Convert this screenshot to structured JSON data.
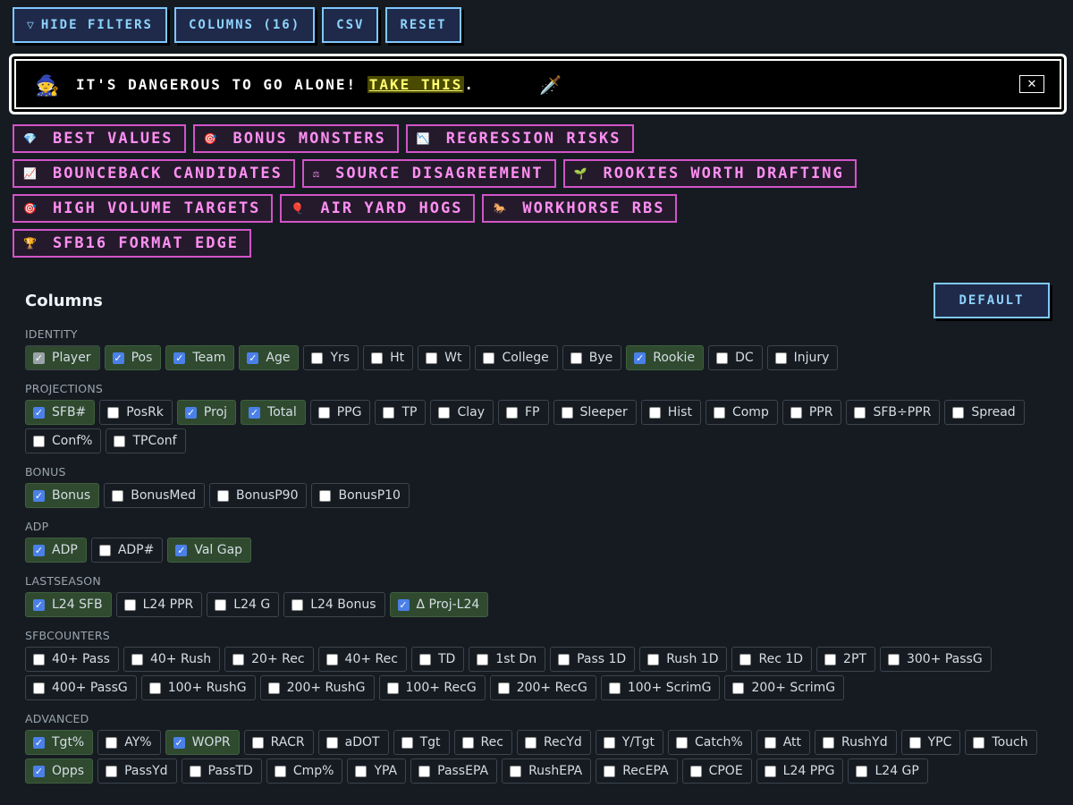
{
  "toolbar": {
    "hide_filters": "HIDE FILTERS",
    "filter_icon": "filter-icon",
    "columns": "COLUMNS (16)",
    "csv": "CSV",
    "reset": "RESET"
  },
  "banner": {
    "icon": "wizard-icon",
    "text_before": "IT'S DANGEROUS TO GO ALONE! ",
    "highlight": "TAKE THIS",
    "text_after": ".",
    "sword_icon": "sword-icon",
    "close": "✕"
  },
  "presets": [
    [
      {
        "label": "BEST VALUES",
        "icon": "💎"
      },
      {
        "label": "BONUS MONSTERS",
        "icon": "🎯"
      },
      {
        "label": "REGRESSION RISKS",
        "icon": "📉"
      }
    ],
    [
      {
        "label": "BOUNCEBACK CANDIDATES",
        "icon": "📈"
      },
      {
        "label": "SOURCE DISAGREEMENT",
        "icon": "⚖"
      },
      {
        "label": "ROOKIES WORTH DRAFTING",
        "icon": "🌱"
      }
    ],
    [
      {
        "label": "HIGH VOLUME TARGETS",
        "icon": "🎯"
      },
      {
        "label": "AIR YARD HOGS",
        "icon": "🎈"
      },
      {
        "label": "WORKHORSE RBS",
        "icon": "🐎"
      }
    ],
    [
      {
        "label": "SFB16 FORMAT EDGE",
        "icon": "🏆"
      }
    ]
  ],
  "columns_panel": {
    "title": "Columns",
    "default_button": "DEFAULT",
    "groups": [
      {
        "name": "IDENTITY",
        "items": [
          {
            "label": "Player",
            "checked": true,
            "locked": true
          },
          {
            "label": "Pos",
            "checked": true
          },
          {
            "label": "Team",
            "checked": true
          },
          {
            "label": "Age",
            "checked": true
          },
          {
            "label": "Yrs",
            "checked": false
          },
          {
            "label": "Ht",
            "checked": false
          },
          {
            "label": "Wt",
            "checked": false
          },
          {
            "label": "College",
            "checked": false
          },
          {
            "label": "Bye",
            "checked": false
          },
          {
            "label": "Rookie",
            "checked": true
          },
          {
            "label": "DC",
            "checked": false
          },
          {
            "label": "Injury",
            "checked": false
          }
        ]
      },
      {
        "name": "PROJECTIONS",
        "items": [
          {
            "label": "SFB#",
            "checked": true
          },
          {
            "label": "PosRk",
            "checked": false
          },
          {
            "label": "Proj",
            "checked": true
          },
          {
            "label": "Total",
            "checked": true
          },
          {
            "label": "PPG",
            "checked": false
          },
          {
            "label": "TP",
            "checked": false
          },
          {
            "label": "Clay",
            "checked": false
          },
          {
            "label": "FP",
            "checked": false
          },
          {
            "label": "Sleeper",
            "checked": false
          },
          {
            "label": "Hist",
            "checked": false
          },
          {
            "label": "Comp",
            "checked": false
          },
          {
            "label": "PPR",
            "checked": false
          },
          {
            "label": "SFB÷PPR",
            "checked": false
          },
          {
            "label": "Spread",
            "checked": false
          },
          {
            "label": "Conf%",
            "checked": false
          },
          {
            "label": "TPConf",
            "checked": false
          }
        ]
      },
      {
        "name": "BONUS",
        "items": [
          {
            "label": "Bonus",
            "checked": true
          },
          {
            "label": "BonusMed",
            "checked": false
          },
          {
            "label": "BonusP90",
            "checked": false
          },
          {
            "label": "BonusP10",
            "checked": false
          }
        ]
      },
      {
        "name": "ADP",
        "items": [
          {
            "label": "ADP",
            "checked": true
          },
          {
            "label": "ADP#",
            "checked": false
          },
          {
            "label": "Val Gap",
            "checked": true
          }
        ]
      },
      {
        "name": "LASTSEASON",
        "items": [
          {
            "label": "L24 SFB",
            "checked": true
          },
          {
            "label": "L24 PPR",
            "checked": false
          },
          {
            "label": "L24 G",
            "checked": false
          },
          {
            "label": "L24 Bonus",
            "checked": false
          },
          {
            "label": "Δ Proj-L24",
            "checked": true
          }
        ]
      },
      {
        "name": "SFBCOUNTERS",
        "items": [
          {
            "label": "40+ Pass",
            "checked": false
          },
          {
            "label": "40+ Rush",
            "checked": false
          },
          {
            "label": "20+ Rec",
            "checked": false
          },
          {
            "label": "40+ Rec",
            "checked": false
          },
          {
            "label": "TD",
            "checked": false
          },
          {
            "label": "1st Dn",
            "checked": false
          },
          {
            "label": "Pass 1D",
            "checked": false
          },
          {
            "label": "Rush 1D",
            "checked": false
          },
          {
            "label": "Rec 1D",
            "checked": false
          },
          {
            "label": "2PT",
            "checked": false
          },
          {
            "label": "300+ PassG",
            "checked": false
          },
          {
            "label": "400+ PassG",
            "checked": false
          },
          {
            "label": "100+ RushG",
            "checked": false
          },
          {
            "label": "200+ RushG",
            "checked": false
          },
          {
            "label": "100+ RecG",
            "checked": false
          },
          {
            "label": "200+ RecG",
            "checked": false
          },
          {
            "label": "100+ ScrimG",
            "checked": false
          },
          {
            "label": "200+ ScrimG",
            "checked": false
          }
        ]
      },
      {
        "name": "ADVANCED",
        "items": [
          {
            "label": "Tgt%",
            "checked": true
          },
          {
            "label": "AY%",
            "checked": false
          },
          {
            "label": "WOPR",
            "checked": true
          },
          {
            "label": "RACR",
            "checked": false
          },
          {
            "label": "aDOT",
            "checked": false
          },
          {
            "label": "Tgt",
            "checked": false
          },
          {
            "label": "Rec",
            "checked": false
          },
          {
            "label": "RecYd",
            "checked": false
          },
          {
            "label": "Y/Tgt",
            "checked": false
          },
          {
            "label": "Catch%",
            "checked": false
          },
          {
            "label": "Att",
            "checked": false
          },
          {
            "label": "RushYd",
            "checked": false
          },
          {
            "label": "YPC",
            "checked": false
          },
          {
            "label": "Touch",
            "checked": false
          },
          {
            "label": "Opps",
            "checked": true
          },
          {
            "label": "PassYd",
            "checked": false
          },
          {
            "label": "PassTD",
            "checked": false
          },
          {
            "label": "Cmp%",
            "checked": false
          },
          {
            "label": "YPA",
            "checked": false
          },
          {
            "label": "PassEPA",
            "checked": false
          },
          {
            "label": "RushEPA",
            "checked": false
          },
          {
            "label": "RecEPA",
            "checked": false
          },
          {
            "label": "CPOE",
            "checked": false
          },
          {
            "label": "L24 PPG",
            "checked": false
          },
          {
            "label": "L24 GP",
            "checked": false
          }
        ]
      }
    ]
  }
}
